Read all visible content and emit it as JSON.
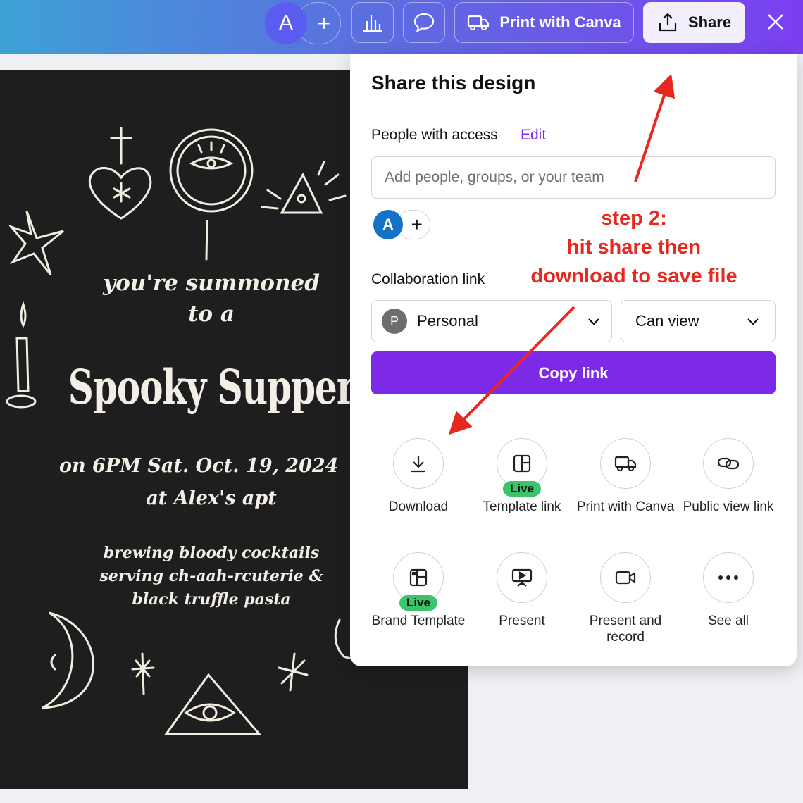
{
  "topbar": {
    "avatar_initial": "A",
    "add_symbol": "+",
    "print_label": "Print with Canva",
    "share_label": "Share",
    "icons": [
      "insights-icon",
      "comment-icon",
      "truck-icon",
      "share-icon",
      "close-icon"
    ]
  },
  "design": {
    "line1": "you're summoned",
    "line2": "to a",
    "title": "Spooky Supper",
    "when": "on 6PM Sat. Oct. 19, 2024",
    "where": "at Alex's apt",
    "details": [
      "brewing bloody cocktails",
      "serving ch-aah-rcuterie &",
      "black truffle pasta"
    ]
  },
  "share_panel": {
    "title": "Share this design",
    "access_label": "People with access",
    "edit_label": "Edit",
    "people_placeholder": "Add people, groups, or your team",
    "member_initial": "A",
    "add_symbol": "+",
    "collab_label": "Collaboration link",
    "link_scope_badge": "P",
    "link_scope": "Personal",
    "permission": "Can view",
    "copy_label": "Copy link",
    "options": [
      {
        "label": "Download",
        "icon": "download-icon",
        "badge": ""
      },
      {
        "label": "Template link",
        "icon": "template-icon",
        "badge": "Live"
      },
      {
        "label": "Print with Canva",
        "icon": "truck-icon",
        "badge": ""
      },
      {
        "label": "Public view link",
        "icon": "link-icon",
        "badge": ""
      },
      {
        "label": "Brand Template",
        "icon": "brand-template-icon",
        "badge": "Live"
      },
      {
        "label": "Present",
        "icon": "present-icon",
        "badge": ""
      },
      {
        "label": "Present and record",
        "icon": "camera-icon",
        "badge": ""
      },
      {
        "label": "See all",
        "icon": "more-icon",
        "badge": ""
      }
    ]
  },
  "annotation": {
    "lines": [
      "step 2:",
      "hit share then",
      "download to save file"
    ],
    "color": "#e8271f"
  },
  "colors": {
    "brand_purple": "#7d2ae8",
    "live_green": "#3cc46c",
    "design_bg": "#1e1e1e"
  }
}
